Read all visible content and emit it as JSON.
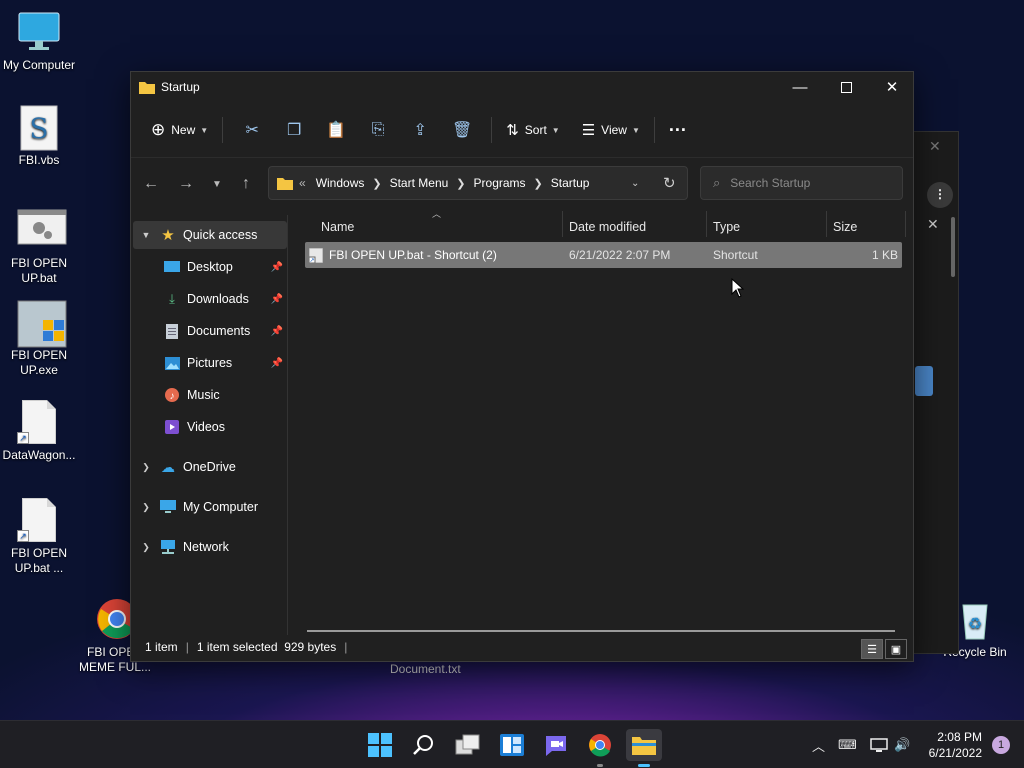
{
  "desktop": {
    "icons": [
      {
        "label": "My Computer"
      },
      {
        "label": "FBI.vbs"
      },
      {
        "label": "FBI OPEN UP.bat"
      },
      {
        "label": "FBI OPEN UP.exe"
      },
      {
        "label": "DataWagon..."
      },
      {
        "label": "FBI OPEN UP.bat ..."
      },
      {
        "label": "FBI OPEN MEME FUL..."
      },
      {
        "label": "Document.txt"
      },
      {
        "label": "Recycle Bin"
      }
    ]
  },
  "window": {
    "title": "Startup",
    "toolbar": {
      "new_label": "New",
      "sort_label": "Sort",
      "view_label": "View",
      "more_label": "···"
    },
    "address": {
      "overflow": "«",
      "crumbs": [
        "Windows",
        "Start Menu",
        "Programs",
        "Startup"
      ]
    },
    "search": {
      "placeholder": "Search Startup"
    },
    "sidebar": {
      "quick_access": "Quick access",
      "items": [
        {
          "label": "Desktop"
        },
        {
          "label": "Downloads"
        },
        {
          "label": "Documents"
        },
        {
          "label": "Pictures"
        },
        {
          "label": "Music"
        },
        {
          "label": "Videos"
        }
      ],
      "onedrive": "OneDrive",
      "my_computer": "My Computer",
      "network": "Network"
    },
    "columns": [
      "Name",
      "Date modified",
      "Type",
      "Size"
    ],
    "files": [
      {
        "name": "FBI OPEN UP.bat - Shortcut (2)",
        "date": "6/21/2022 2:07 PM",
        "type": "Shortcut",
        "size": "1 KB"
      }
    ],
    "status": {
      "count": "1 item",
      "selection": "1 item selected  929 bytes"
    }
  },
  "taskbar": {
    "time": "2:08 PM",
    "date": "6/21/2022",
    "notifications": "1"
  },
  "colors": {
    "accent": "#4cc2ff",
    "folder": "#f4c542",
    "selection_row": "#777777",
    "window_bg": "#202020"
  }
}
